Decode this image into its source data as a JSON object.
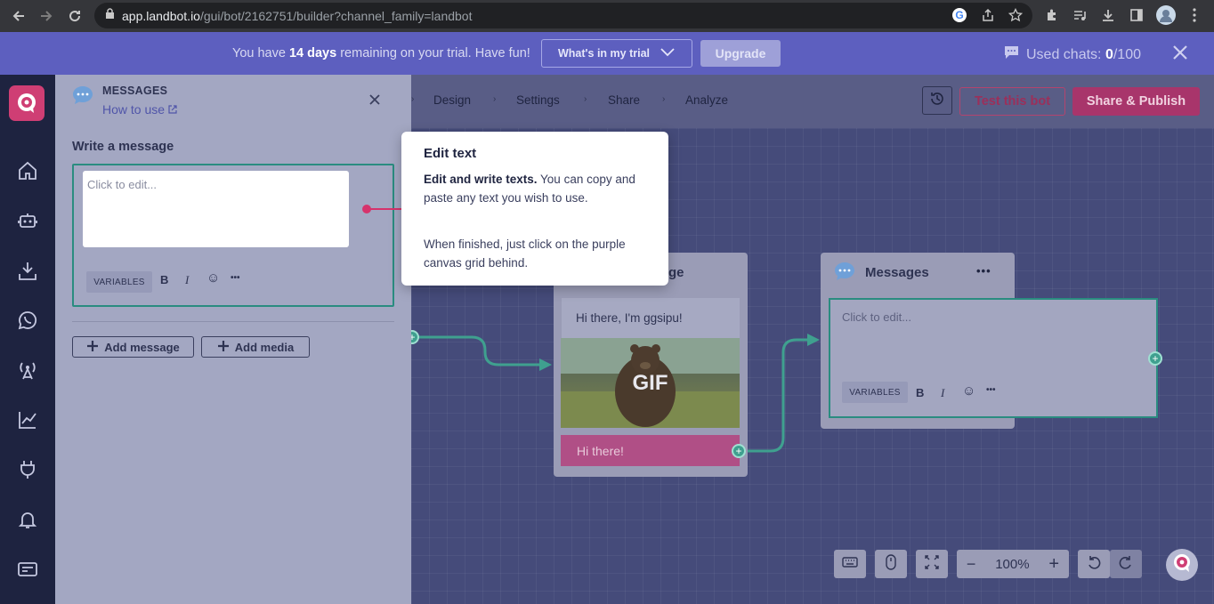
{
  "browser": {
    "url_host": "app.landbot.io",
    "url_path": "/gui/bot/2162751/builder?channel_family=landbot"
  },
  "banner": {
    "text_before": "You have ",
    "days": "14 days",
    "text_after": " remaining on your trial. Have fun!",
    "whats_label": "What's in my trial",
    "upgrade_label": "Upgrade",
    "used_label": "Used chats: ",
    "used_count": "0",
    "used_total": "/100"
  },
  "panel": {
    "title": "MESSAGES",
    "how_to": "How to use",
    "write_label": "Write a message",
    "editor_placeholder": "Click to edit...",
    "variables_label": "VARIABLES",
    "bold_label": "B",
    "italic_label": "I",
    "emoji_label": "☺",
    "more_label": "•••",
    "add_message": "Add message",
    "add_media": "Add media"
  },
  "topnav": {
    "links": [
      "Design",
      "Settings",
      "Share",
      "Analyze"
    ],
    "test_label": "Test this bot",
    "share_label": "Share & Publish"
  },
  "tooltip": {
    "title": "Edit text",
    "bold_text": "Edit and write texts.",
    "body_rest": " You can copy and paste any text you wish to use.",
    "body2": "When finished, just click on the purple canvas grid behind."
  },
  "node1": {
    "title_partial": "ge",
    "greeting": "Hi there, I'm ggsipu!",
    "gif_label": "GIF",
    "button_label": "Hi there!"
  },
  "node2": {
    "title": "Messages",
    "more_label": "•••",
    "placeholder": "Click to edit...",
    "variables_label": "VARIABLES",
    "bold_label": "B",
    "italic_label": "I",
    "emoji_label": "☺",
    "fmt_more_label": "•••"
  },
  "zoom": {
    "minus": "−",
    "level": "100%",
    "plus": "+"
  },
  "colors": {
    "brand": "#cf3e74",
    "banner": "#5d5fbf",
    "nav": "#1e2340",
    "teal": "#2a8c80"
  }
}
